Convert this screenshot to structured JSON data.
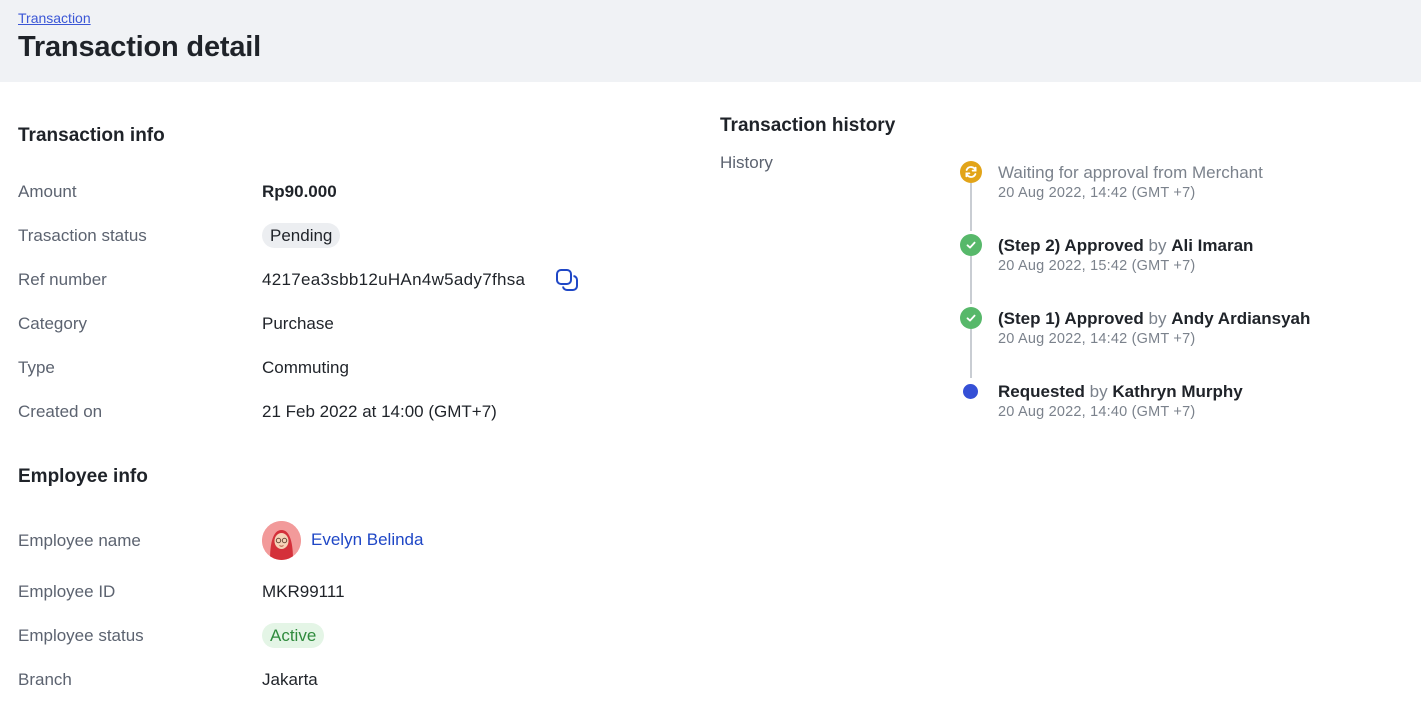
{
  "header": {
    "breadcrumb": "Transaction",
    "title": "Transaction detail"
  },
  "transaction_info": {
    "title": "Transaction info",
    "rows": [
      {
        "label": "Amount",
        "value": "Rp90.000"
      },
      {
        "label": "Trasaction status",
        "value": "Pending"
      },
      {
        "label": "Ref number",
        "value": "4217ea3sbb12uHAn4w5ady7fhsa"
      },
      {
        "label": "Category",
        "value": "Purchase"
      },
      {
        "label": "Type",
        "value": "Commuting"
      },
      {
        "label": "Created on",
        "value": "21 Feb 2022 at 14:00 (GMT+7)"
      }
    ]
  },
  "employee_info": {
    "title": "Employee info",
    "rows": [
      {
        "label": "Employee name",
        "value": "Evelyn Belinda"
      },
      {
        "label": "Employee ID",
        "value": "MKR99111"
      },
      {
        "label": "Employee status",
        "value": "Active"
      },
      {
        "label": "Branch",
        "value": "Jakarta"
      }
    ]
  },
  "history": {
    "title": "Transaction history",
    "label": "History",
    "by_word": "by",
    "events": [
      {
        "status": "waiting",
        "text": "Waiting for approval from Merchant",
        "time": "20 Aug 2022, 14:42 (GMT +7)"
      },
      {
        "status": "approved",
        "action": "(Step 2) Approved",
        "actor": "Ali Imaran",
        "time": "20 Aug 2022, 15:42 (GMT +7)"
      },
      {
        "status": "approved",
        "action": "(Step 1) Approved",
        "actor": "Andy Ardiansyah",
        "time": "20 Aug 2022, 14:42 (GMT +7)"
      },
      {
        "status": "requested",
        "action": "Requested",
        "actor": "Kathryn Murphy",
        "time": "20 Aug 2022, 14:40 (GMT +7)"
      }
    ]
  },
  "colors": {
    "accent": "#3550d6",
    "link": "#1f47c6",
    "waiting": "#e2a419",
    "approved": "#57b86a",
    "active_text": "#2f8b3d",
    "header_bg": "#f0f2f5"
  },
  "icons": {
    "copy": "copy-icon",
    "waiting": "sync-icon",
    "approved": "check-icon",
    "requested": "dot-icon"
  }
}
